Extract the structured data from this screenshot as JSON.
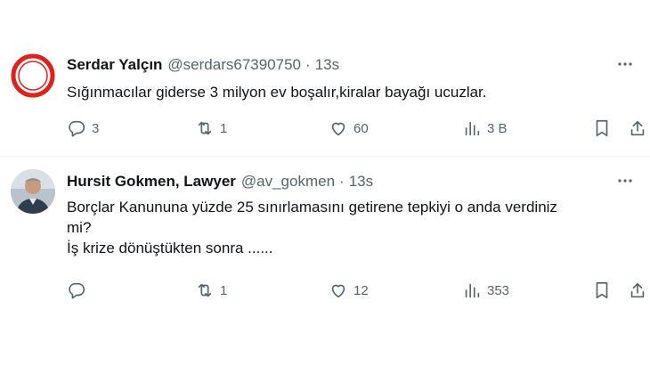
{
  "tweets": [
    {
      "name": "Serdar Yalçın",
      "handle": "@serdars67390750",
      "dot": "·",
      "time": "13s",
      "text_lines": [
        "Sığınmacılar giderse 3 milyon ev boşalır,kiralar bayağı ucuzlar."
      ],
      "reply_count": "3",
      "retweet_count": "1",
      "like_count": "60",
      "view_count": "3 B",
      "avatar": {
        "type": "red-circle-logo",
        "color": "#e0201b"
      }
    },
    {
      "name": "Hursit Gokmen, Lawyer",
      "handle": "@av_gokmen",
      "dot": "·",
      "time": "13s",
      "text_lines": [
        "Borçlar Kanununa yüzde 25 sınırlamasını getirene tepkiyi o anda verdiniz",
        "mi?",
        "İş krize dönüştükten sonra ......"
      ],
      "reply_count": "",
      "retweet_count": "1",
      "like_count": "12",
      "view_count": "353",
      "avatar": {
        "type": "photo"
      }
    }
  ],
  "icons": [
    "more-icon",
    "reply-icon",
    "retweet-icon",
    "like-icon",
    "views-icon",
    "bookmark-icon",
    "share-icon"
  ],
  "colors": {
    "text": "#0f1419",
    "secondary": "#536471",
    "divider": "#eff3f4",
    "accent_red": "#e0201b"
  }
}
